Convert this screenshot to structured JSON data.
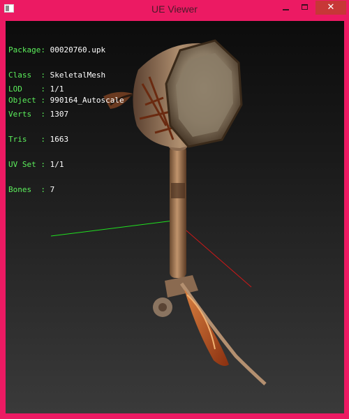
{
  "window": {
    "title": "UE Viewer",
    "controls": {
      "minimize": "minimize-icon",
      "maximize": "maximize-icon",
      "close": "close-icon",
      "close_glyph": "✕",
      "close_color": "#c73737"
    }
  },
  "info_block_1": [
    {
      "key": "Package:",
      "value": "00020760.upk"
    },
    {
      "key": "Class  :",
      "value": "SkeletalMesh"
    },
    {
      "key": "Object :",
      "value": "990164_Autoscale"
    }
  ],
  "info_block_2": [
    {
      "key": "LOD    :",
      "value": "1/1"
    },
    {
      "key": "Verts  :",
      "value": "1307"
    },
    {
      "key": "Tris   :",
      "value": "1663"
    },
    {
      "key": "UV Set :",
      "value": "1/1"
    },
    {
      "key": "Bones  :",
      "value": "7"
    }
  ],
  "colors": {
    "label": "#5cf05c",
    "value": "#ffffff",
    "axis_x": "#d01818",
    "axis_y": "#20e020",
    "frame": "#ec1a63"
  }
}
